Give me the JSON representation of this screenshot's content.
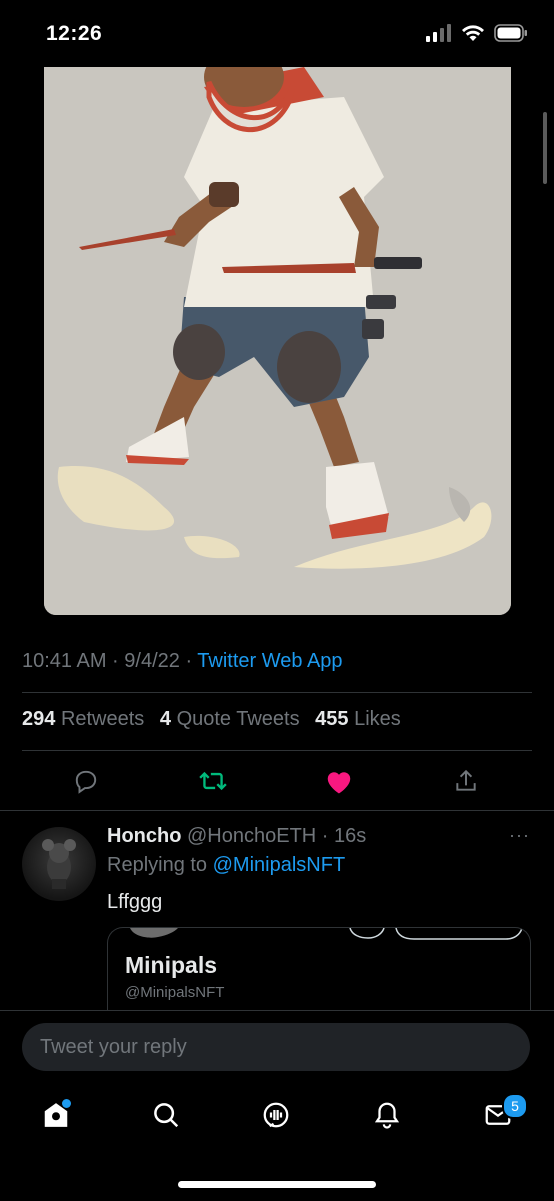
{
  "status_bar": {
    "time": "12:26"
  },
  "tweet": {
    "timestamp": "10:41 AM · 9/4/22 · ",
    "source": "Twitter Web App",
    "retweets_count": "294",
    "retweets_label": "Retweets",
    "quotes_count": "4",
    "quotes_label": "Quote Tweets",
    "likes_count": "455",
    "likes_label": "Likes",
    "liked": true
  },
  "reply": {
    "name": "Honcho",
    "handle": "@HonchoETH",
    "time": " · 16s",
    "replying_prefix": "Replying to ",
    "replying_to": "@MinipalsNFT",
    "text": "Lffggg",
    "more": "···",
    "card": {
      "title": "Minipals",
      "handle": "@MinipalsNFT"
    }
  },
  "compose": {
    "placeholder": "Tweet your reply"
  },
  "tabbar": {
    "messages_badge": "5"
  },
  "colors": {
    "accent": "#1d9bf0",
    "retweet": "#00ba7c",
    "like": "#f91880",
    "background": "#000000"
  },
  "icons": [
    "signal-icon",
    "wifi-icon",
    "battery-icon",
    "reply-icon",
    "retweet-icon",
    "like-icon",
    "share-icon",
    "home-icon",
    "search-icon",
    "spaces-icon",
    "notifications-icon",
    "messages-icon"
  ]
}
